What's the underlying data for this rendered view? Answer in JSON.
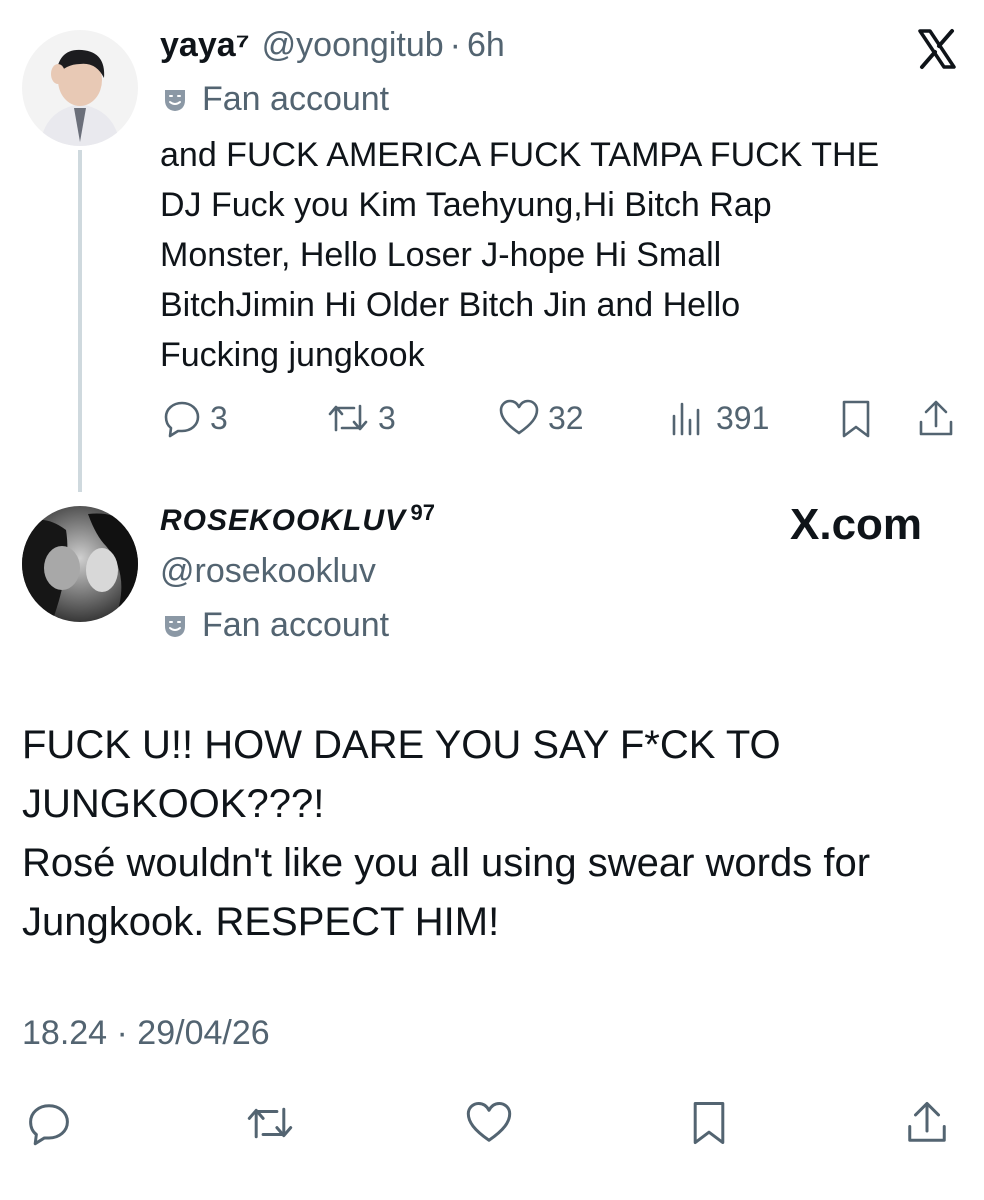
{
  "tweet1": {
    "display_name": "yaya⁷",
    "handle": "@yoongitub",
    "separator": "·",
    "time": "6h",
    "badge": "Fan account",
    "brand_icon": "x-logo-icon",
    "lines": [
      "and FUCK AMERICA FUCK TAMPA FUCK THE",
      "DJ Fuck you Kim Taehyung,Hi Bitch Rap",
      "Monster, Hello Loser J-hope Hi Small",
      "BitchJimin Hi Older Bitch Jin and Hello",
      "Fucking jungkook"
    ],
    "actions": {
      "replies": "3",
      "reposts": "3",
      "likes": "32",
      "views": "391"
    }
  },
  "tweet2": {
    "display_name": "ROSEKOOKLUV",
    "name_sup": "97",
    "handle": "@rosekookluv",
    "badge": "Fan account",
    "brand_text": "X.com",
    "lines": [
      "FUCK U!! HOW DARE YOU SAY F*CK TO",
      "JUNGKOOK???!",
      "Rosé wouldn't like you all using swear words for",
      "Jungkook. RESPECT HIM!"
    ],
    "timestamp": "18.24 · 29/04/26"
  },
  "colors": {
    "text": "#0f1419",
    "muted": "#536471",
    "thread_line": "#cfd9de"
  }
}
